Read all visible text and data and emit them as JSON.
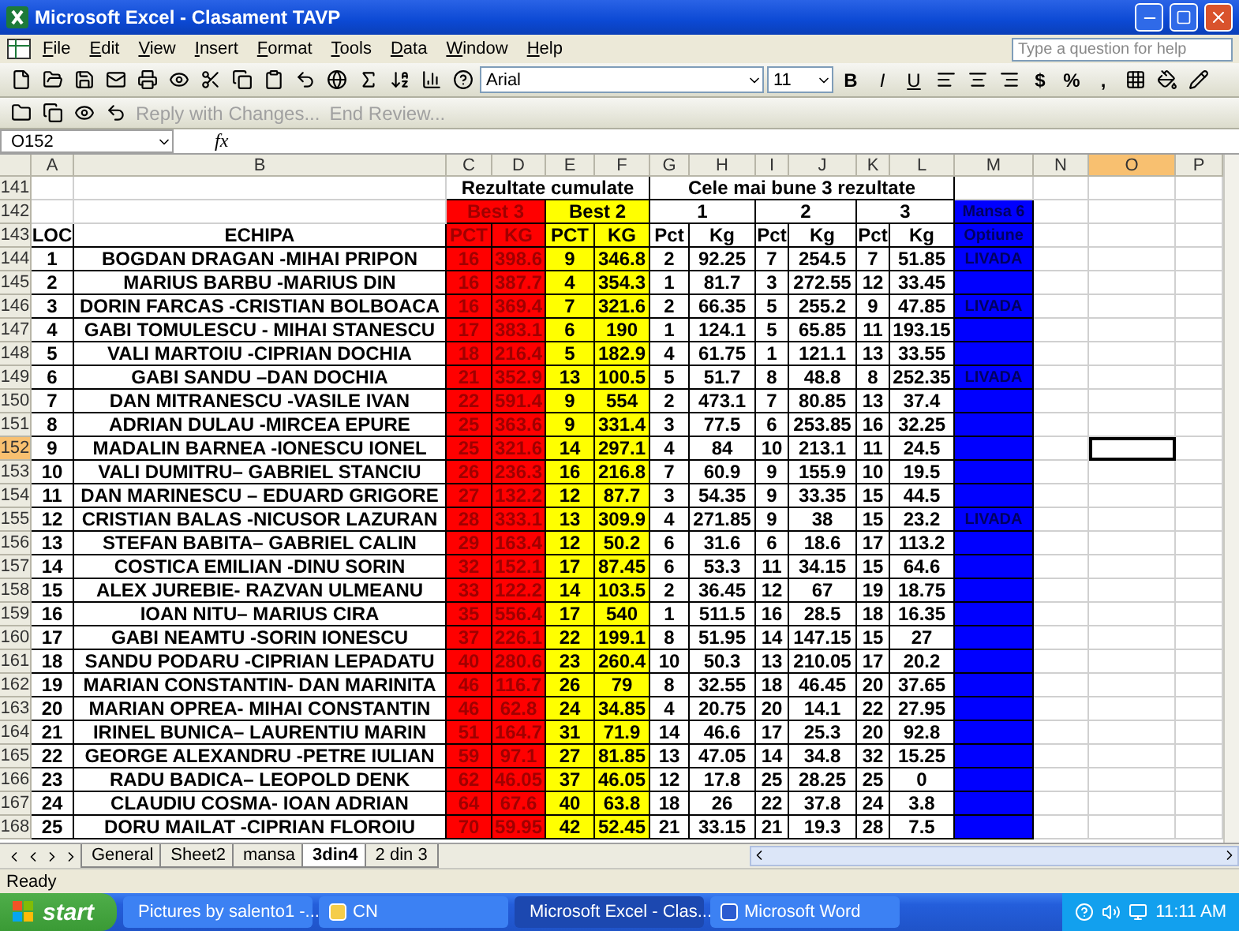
{
  "window": {
    "title": "Microsoft Excel - Clasament TAVP"
  },
  "menu": [
    "File",
    "Edit",
    "View",
    "Insert",
    "Format",
    "Tools",
    "Data",
    "Window",
    "Help"
  ],
  "help_field": {
    "placeholder": "Type a question for help"
  },
  "format_toolbar": {
    "font": "Arial",
    "size": "11",
    "style_buttons": [
      "B",
      "I",
      "U"
    ],
    "number_buttons": [
      "$",
      "%",
      ","
    ]
  },
  "review_toolbar": [
    {
      "label": "Reply with Changes...",
      "disabled": true
    },
    {
      "label": "End Review...",
      "disabled": true
    }
  ],
  "formula_bar": {
    "name_box": "O152",
    "fx": "fx"
  },
  "columns": [
    {
      "label": "A",
      "selected": false
    },
    {
      "label": "B",
      "selected": false
    },
    {
      "label": "C",
      "selected": false
    },
    {
      "label": "D",
      "selected": false
    },
    {
      "label": "E",
      "selected": false
    },
    {
      "label": "F",
      "selected": false
    },
    {
      "label": "G",
      "selected": false
    },
    {
      "label": "H",
      "selected": false
    },
    {
      "label": "I",
      "selected": false
    },
    {
      "label": "J",
      "selected": false
    },
    {
      "label": "K",
      "selected": false
    },
    {
      "label": "L",
      "selected": false
    },
    {
      "label": "M",
      "selected": false
    },
    {
      "label": "N",
      "selected": false
    },
    {
      "label": "O",
      "selected": true
    },
    {
      "label": "P",
      "selected": false
    }
  ],
  "header": {
    "rows": [
      "141",
      "142",
      "143"
    ],
    "group_titles": [
      "Rezultate cumulate",
      "Cele mai bune 3 rezultate"
    ],
    "subgroups": [
      {
        "label": "Best 3",
        "kind": "best3"
      },
      {
        "label": "Best 2",
        "kind": "best2"
      },
      {
        "label": "1",
        "kind": "round"
      },
      {
        "label": "2",
        "kind": "round"
      },
      {
        "label": "3",
        "kind": "round"
      }
    ],
    "mansa_6": "Mansa 6",
    "columns": [
      "LOC",
      "ECHIPA",
      "PCT",
      "KG",
      "PCT",
      "KG",
      "Pct",
      "Kg",
      "Pct",
      "Kg",
      "Pct",
      "Kg",
      "Optiune"
    ]
  },
  "rows": [
    {
      "row": "144",
      "selected": false,
      "loc": "1",
      "team": "BOGDAN DRAGAN -MIHAI PRIPON",
      "values": [
        "16",
        "398.6",
        "9",
        "346.8",
        "2",
        "92.25",
        "7",
        "254.5",
        "7",
        "51.85"
      ],
      "mansa_6": "LIVADA"
    },
    {
      "row": "145",
      "selected": false,
      "loc": "2",
      "team": "MARIUS BARBU -MARIUS DIN",
      "values": [
        "16",
        "387.7",
        "4",
        "354.3",
        "1",
        "81.7",
        "3",
        "272.55",
        "12",
        "33.45"
      ]
    },
    {
      "row": "146",
      "selected": false,
      "loc": "3",
      "team": "DORIN FARCAS -CRISTIAN BOLBOACA",
      "values": [
        "16",
        "369.4",
        "7",
        "321.6",
        "2",
        "66.35",
        "5",
        "255.2",
        "9",
        "47.85"
      ],
      "mansa_6": "LIVADA"
    },
    {
      "row": "147",
      "selected": false,
      "loc": "4",
      "team": "GABI TOMULESCU - MIHAI STANESCU",
      "values": [
        "17",
        "383.1",
        "6",
        "190",
        "1",
        "124.1",
        "5",
        "65.85",
        "11",
        "193.15"
      ]
    },
    {
      "row": "148",
      "selected": false,
      "loc": "5",
      "team": "VALI MARTOIU -CIPRIAN DOCHIA",
      "values": [
        "18",
        "216.4",
        "5",
        "182.9",
        "4",
        "61.75",
        "1",
        "121.1",
        "13",
        "33.55"
      ]
    },
    {
      "row": "149",
      "selected": false,
      "loc": "6",
      "team": "GABI SANDU –DAN DOCHIA",
      "values": [
        "21",
        "352.9",
        "13",
        "100.5",
        "5",
        "51.7",
        "8",
        "48.8",
        "8",
        "252.35"
      ],
      "mansa_6": "LIVADA"
    },
    {
      "row": "150",
      "selected": false,
      "loc": "7",
      "team": "DAN MITRANESCU -VASILE IVAN",
      "values": [
        "22",
        "591.4",
        "9",
        "554",
        "2",
        "473.1",
        "7",
        "80.85",
        "13",
        "37.4"
      ]
    },
    {
      "row": "151",
      "selected": false,
      "loc": "8",
      "team": "ADRIAN DULAU -MIRCEA EPURE",
      "values": [
        "25",
        "363.6",
        "9",
        "331.4",
        "3",
        "77.5",
        "6",
        "253.85",
        "16",
        "32.25"
      ]
    },
    {
      "row": "152",
      "selected": true,
      "loc": "9",
      "team": "MADALIN BARNEA -IONESCU IONEL",
      "values": [
        "25",
        "321.6",
        "14",
        "297.1",
        "4",
        "84",
        "10",
        "213.1",
        "11",
        "24.5"
      ]
    },
    {
      "row": "153",
      "selected": false,
      "loc": "10",
      "team": "VALI DUMITRU– GABRIEL STANCIU",
      "values": [
        "26",
        "236.3",
        "16",
        "216.8",
        "7",
        "60.9",
        "9",
        "155.9",
        "10",
        "19.5"
      ]
    },
    {
      "row": "154",
      "selected": false,
      "loc": "11",
      "team": "DAN MARINESCU – EDUARD GRIGORE",
      "values": [
        "27",
        "132.2",
        "12",
        "87.7",
        "3",
        "54.35",
        "9",
        "33.35",
        "15",
        "44.5"
      ]
    },
    {
      "row": "155",
      "selected": false,
      "loc": "12",
      "team": "CRISTIAN BALAS -NICUSOR LAZURAN",
      "values": [
        "28",
        "333.1",
        "13",
        "309.9",
        "4",
        "271.85",
        "9",
        "38",
        "15",
        "23.2"
      ],
      "mansa_6": "LIVADA"
    },
    {
      "row": "156",
      "selected": false,
      "loc": "13",
      "team": "STEFAN BABITA– GABRIEL CALIN",
      "values": [
        "29",
        "163.4",
        "12",
        "50.2",
        "6",
        "31.6",
        "6",
        "18.6",
        "17",
        "113.2"
      ]
    },
    {
      "row": "157",
      "selected": false,
      "loc": "14",
      "team": "COSTICA EMILIAN -DINU SORIN",
      "values": [
        "32",
        "152.1",
        "17",
        "87.45",
        "6",
        "53.3",
        "11",
        "34.15",
        "15",
        "64.6"
      ]
    },
    {
      "row": "158",
      "selected": false,
      "loc": "15",
      "team": "ALEX JUREBIE- RAZVAN ULMEANU",
      "values": [
        "33",
        "122.2",
        "14",
        "103.5",
        "2",
        "36.45",
        "12",
        "67",
        "19",
        "18.75"
      ]
    },
    {
      "row": "159",
      "selected": false,
      "loc": "16",
      "team": "IOAN NITU– MARIUS CIRA",
      "values": [
        "35",
        "556.4",
        "17",
        "540",
        "1",
        "511.5",
        "16",
        "28.5",
        "18",
        "16.35"
      ]
    },
    {
      "row": "160",
      "selected": false,
      "loc": "17",
      "team": "GABI NEAMTU -SORIN IONESCU",
      "values": [
        "37",
        "226.1",
        "22",
        "199.1",
        "8",
        "51.95",
        "14",
        "147.15",
        "15",
        "27"
      ]
    },
    {
      "row": "161",
      "selected": false,
      "loc": "18",
      "team": "SANDU PODARU -CIPRIAN LEPADATU",
      "values": [
        "40",
        "280.6",
        "23",
        "260.4",
        "10",
        "50.3",
        "13",
        "210.05",
        "17",
        "20.2"
      ]
    },
    {
      "row": "162",
      "selected": false,
      "loc": "19",
      "team": "MARIAN CONSTANTIN- DAN MARINITA",
      "values": [
        "46",
        "116.7",
        "26",
        "79",
        "8",
        "32.55",
        "18",
        "46.45",
        "20",
        "37.65"
      ]
    },
    {
      "row": "163",
      "selected": false,
      "loc": "20",
      "team": "MARIAN OPREA- MIHAI CONSTANTIN",
      "values": [
        "46",
        "62.8",
        "24",
        "34.85",
        "4",
        "20.75",
        "20",
        "14.1",
        "22",
        "27.95"
      ]
    },
    {
      "row": "164",
      "selected": false,
      "loc": "21",
      "team": "IRINEL BUNICA– LAURENTIU MARIN",
      "values": [
        "51",
        "164.7",
        "31",
        "71.9",
        "14",
        "46.6",
        "17",
        "25.3",
        "20",
        "92.8"
      ]
    },
    {
      "row": "165",
      "selected": false,
      "loc": "22",
      "team": "GEORGE ALEXANDRU -PETRE IULIAN",
      "values": [
        "59",
        "97.1",
        "27",
        "81.85",
        "13",
        "47.05",
        "14",
        "34.8",
        "32",
        "15.25"
      ]
    },
    {
      "row": "166",
      "selected": false,
      "loc": "23",
      "team": "RADU BADICA– LEOPOLD DENK",
      "values": [
        "62",
        "46.05",
        "37",
        "46.05",
        "12",
        "17.8",
        "25",
        "28.25",
        "25",
        "0"
      ]
    },
    {
      "row": "167",
      "selected": false,
      "loc": "24",
      "team": "CLAUDIU COSMA- IOAN ADRIAN",
      "values": [
        "64",
        "67.6",
        "40",
        "63.8",
        "18",
        "26",
        "22",
        "37.8",
        "24",
        "3.8"
      ]
    },
    {
      "row": "168",
      "selected": false,
      "loc": "25",
      "team": "DORU MAILAT -CIPRIAN FLOROIU",
      "values": [
        "70",
        "59.95",
        "42",
        "52.45",
        "21",
        "33.15",
        "21",
        "19.3",
        "28",
        "7.5"
      ]
    }
  ],
  "sheet_tabs": [
    {
      "label": "General",
      "selected": false
    },
    {
      "label": "Sheet2",
      "selected": false
    },
    {
      "label": "mansa",
      "selected": false
    },
    {
      "label": "3din4",
      "selected": true
    },
    {
      "label": "2 din 3",
      "selected": false
    }
  ],
  "status_bar": {
    "text": "Ready"
  },
  "taskbar": {
    "start": "start",
    "items": [
      {
        "label": "Pictures by salento1 -...",
        "kind": "browser",
        "selected": false
      },
      {
        "label": "CN",
        "kind": "folder",
        "selected": false
      },
      {
        "label": "Microsoft Excel - Clas...",
        "kind": "excel",
        "selected": true
      },
      {
        "label": "Microsoft Word",
        "kind": "word",
        "selected": false
      }
    ],
    "clock": "11:11 AM"
  }
}
